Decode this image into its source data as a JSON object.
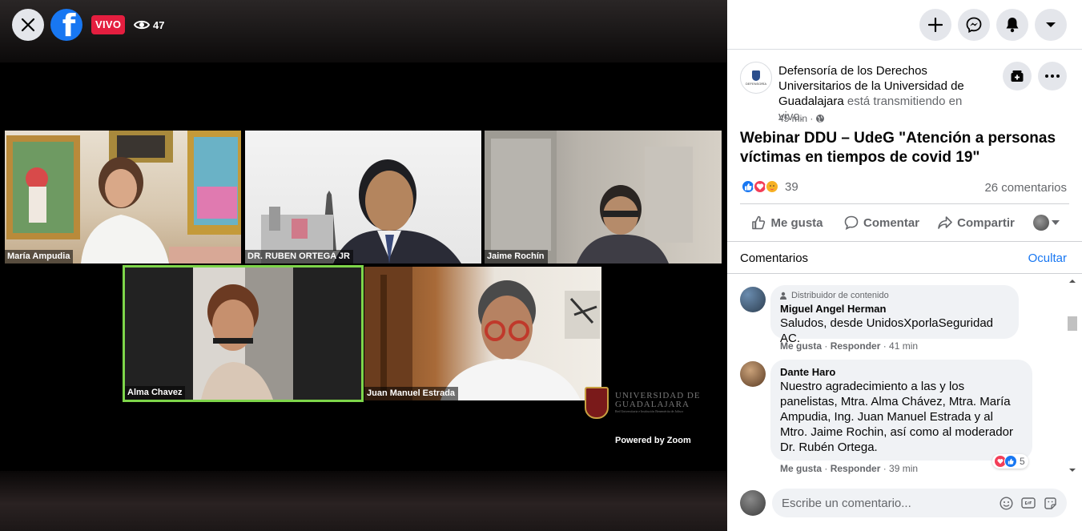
{
  "video": {
    "live_label": "VIVO",
    "viewer_count": "47",
    "participants": [
      {
        "name": "María Ampudia"
      },
      {
        "name": "DR. RUBEN ORTEGA JR"
      },
      {
        "name": "Jaime Rochín"
      },
      {
        "name": "Alma Chavez"
      },
      {
        "name": "Juan Manuel Estrada"
      }
    ],
    "watermark_line1": "UNIVERSIDAD DE",
    "watermark_line2": "GUADALAJARA",
    "watermark_sub": "Red Universitaria e Institución Benemérita de Jalisco",
    "powered_by": "Powered by Zoom"
  },
  "post": {
    "page_name": "Defensoría de los Derechos Universitarios de la Universidad de Guadalajara",
    "status_text": " está transmitiendo en vivo.",
    "time": "45 min ·",
    "avatar_caption": "DEFENSORÍA",
    "title": "Webinar DDU – UdeG \"Atención a personas víctimas en tiempos de covid 19\"",
    "reaction_count": "39",
    "comment_count": "26 comentarios",
    "actions": {
      "like": "Me gusta",
      "comment": "Comentar",
      "share": "Compartir"
    }
  },
  "comments": {
    "title": "Comentarios",
    "hide": "Ocultar",
    "items": [
      {
        "badge": "Distribuidor de contenido",
        "author": "Miguel Angel Herman",
        "text": "Saludos, desde UnidosXporlaSeguridad AC.",
        "like": "Me gusta",
        "reply": "Responder",
        "time": "41 min"
      },
      {
        "author": "Dante Haro",
        "text": "Nuestro agradecimiento a las y los panelistas, Mtra. Alma Chávez, Mtra. María Ampudia, Ing. Juan Manuel Estrada y al Mtro. Jaime Rochin, así como al moderador Dr. Rubén Ortega.",
        "like": "Me gusta",
        "reply": "Responder",
        "time": "39 min",
        "reactions": "5"
      }
    ],
    "write_placeholder": "Escribe un comentario..."
  },
  "colors": {
    "facebook_blue": "#1877f2",
    "live_red": "#e41e3f",
    "active_speaker_border": "#7ed64a"
  }
}
